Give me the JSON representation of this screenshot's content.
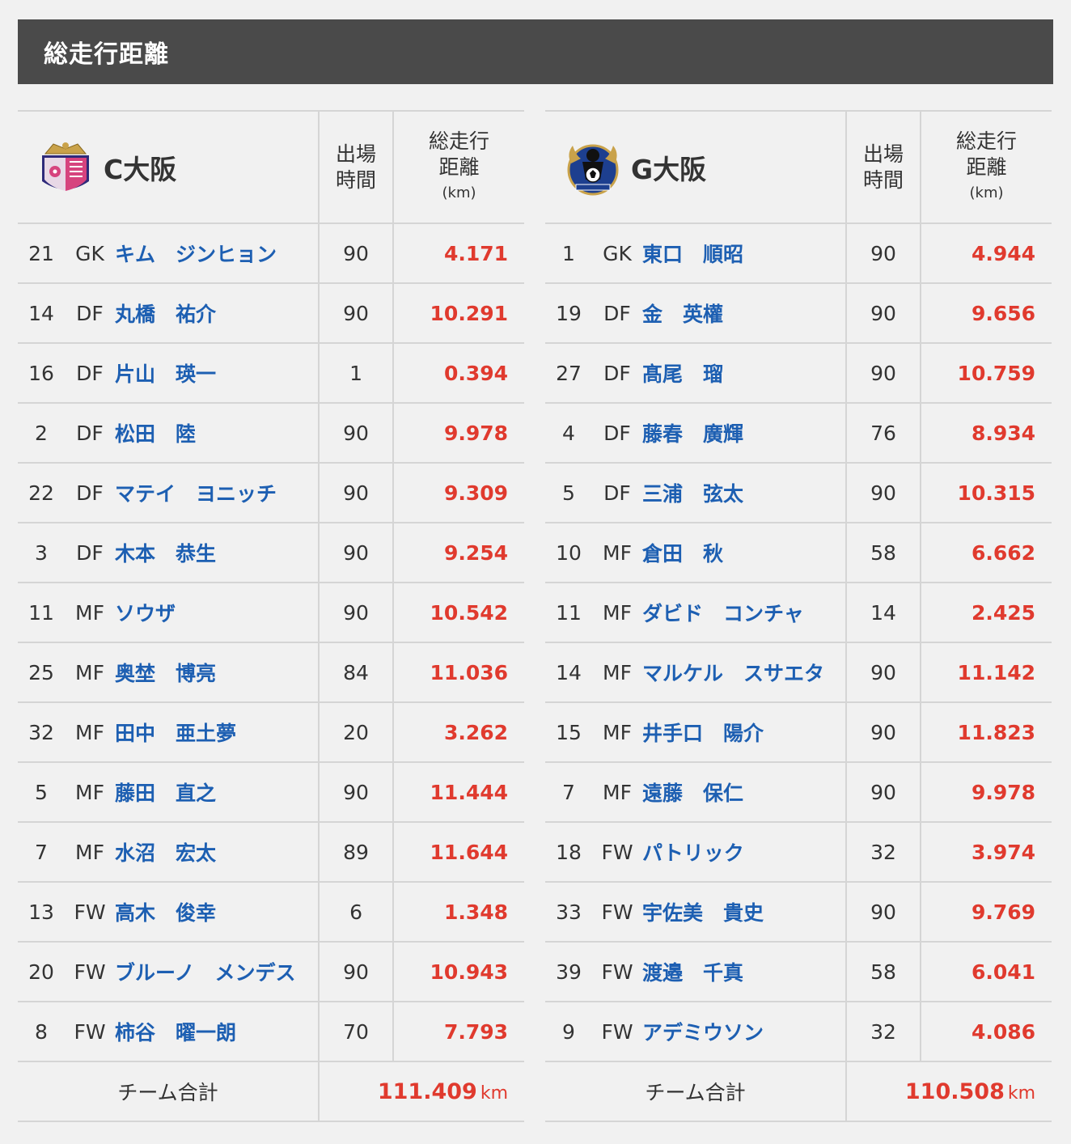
{
  "header": {
    "title": "総走行距離"
  },
  "columns": {
    "minutes_line1": "出場",
    "minutes_line2": "時間",
    "dist_line1": "総走行",
    "dist_line2": "距離",
    "dist_unit": "(km)"
  },
  "teams": [
    {
      "name": "C大阪",
      "crest_icon": "cerezo-osaka-crest-icon",
      "players": [
        {
          "no": "21",
          "pos": "GK",
          "name": "キム　ジンヒョン",
          "minutes": "90",
          "distance": "4.171"
        },
        {
          "no": "14",
          "pos": "DF",
          "name": "丸橋　祐介",
          "minutes": "90",
          "distance": "10.291"
        },
        {
          "no": "16",
          "pos": "DF",
          "name": "片山　瑛一",
          "minutes": "1",
          "distance": "0.394"
        },
        {
          "no": "2",
          "pos": "DF",
          "name": "松田　陸",
          "minutes": "90",
          "distance": "9.978"
        },
        {
          "no": "22",
          "pos": "DF",
          "name": "マテイ　ヨニッチ",
          "minutes": "90",
          "distance": "9.309"
        },
        {
          "no": "3",
          "pos": "DF",
          "name": "木本　恭生",
          "minutes": "90",
          "distance": "9.254"
        },
        {
          "no": "11",
          "pos": "MF",
          "name": "ソウザ",
          "minutes": "90",
          "distance": "10.542"
        },
        {
          "no": "25",
          "pos": "MF",
          "name": "奥埜　博亮",
          "minutes": "84",
          "distance": "11.036"
        },
        {
          "no": "32",
          "pos": "MF",
          "name": "田中　亜土夢",
          "minutes": "20",
          "distance": "3.262"
        },
        {
          "no": "5",
          "pos": "MF",
          "name": "藤田　直之",
          "minutes": "90",
          "distance": "11.444"
        },
        {
          "no": "7",
          "pos": "MF",
          "name": "水沼　宏太",
          "minutes": "89",
          "distance": "11.644"
        },
        {
          "no": "13",
          "pos": "FW",
          "name": "高木　俊幸",
          "minutes": "6",
          "distance": "1.348"
        },
        {
          "no": "20",
          "pos": "FW",
          "name": "ブルーノ　メンデス",
          "minutes": "90",
          "distance": "10.943"
        },
        {
          "no": "8",
          "pos": "FW",
          "name": "柿谷　曜一朗",
          "minutes": "70",
          "distance": "7.793"
        }
      ],
      "total_label": "チーム合計",
      "total": "111.409",
      "total_unit": "km"
    },
    {
      "name": "G大阪",
      "crest_icon": "gamba-osaka-crest-icon",
      "players": [
        {
          "no": "1",
          "pos": "GK",
          "name": "東口　順昭",
          "minutes": "90",
          "distance": "4.944"
        },
        {
          "no": "19",
          "pos": "DF",
          "name": "金　英權",
          "minutes": "90",
          "distance": "9.656"
        },
        {
          "no": "27",
          "pos": "DF",
          "name": "髙尾　瑠",
          "minutes": "90",
          "distance": "10.759"
        },
        {
          "no": "4",
          "pos": "DF",
          "name": "藤春　廣輝",
          "minutes": "76",
          "distance": "8.934"
        },
        {
          "no": "5",
          "pos": "DF",
          "name": "三浦　弦太",
          "minutes": "90",
          "distance": "10.315"
        },
        {
          "no": "10",
          "pos": "MF",
          "name": "倉田　秋",
          "minutes": "58",
          "distance": "6.662"
        },
        {
          "no": "11",
          "pos": "MF",
          "name": "ダビド　コンチャ",
          "minutes": "14",
          "distance": "2.425"
        },
        {
          "no": "14",
          "pos": "MF",
          "name": "マルケル　スサエタ",
          "minutes": "90",
          "distance": "11.142"
        },
        {
          "no": "15",
          "pos": "MF",
          "name": "井手口　陽介",
          "minutes": "90",
          "distance": "11.823"
        },
        {
          "no": "7",
          "pos": "MF",
          "name": "遠藤　保仁",
          "minutes": "90",
          "distance": "9.978"
        },
        {
          "no": "18",
          "pos": "FW",
          "name": "パトリック",
          "minutes": "32",
          "distance": "3.974"
        },
        {
          "no": "33",
          "pos": "FW",
          "name": "宇佐美　貴史",
          "minutes": "90",
          "distance": "9.769"
        },
        {
          "no": "39",
          "pos": "FW",
          "name": "渡邉　千真",
          "minutes": "58",
          "distance": "6.041"
        },
        {
          "no": "9",
          "pos": "FW",
          "name": "アデミウソン",
          "minutes": "32",
          "distance": "4.086"
        }
      ],
      "total_label": "チーム合計",
      "total": "110.508",
      "total_unit": "km"
    }
  ]
}
